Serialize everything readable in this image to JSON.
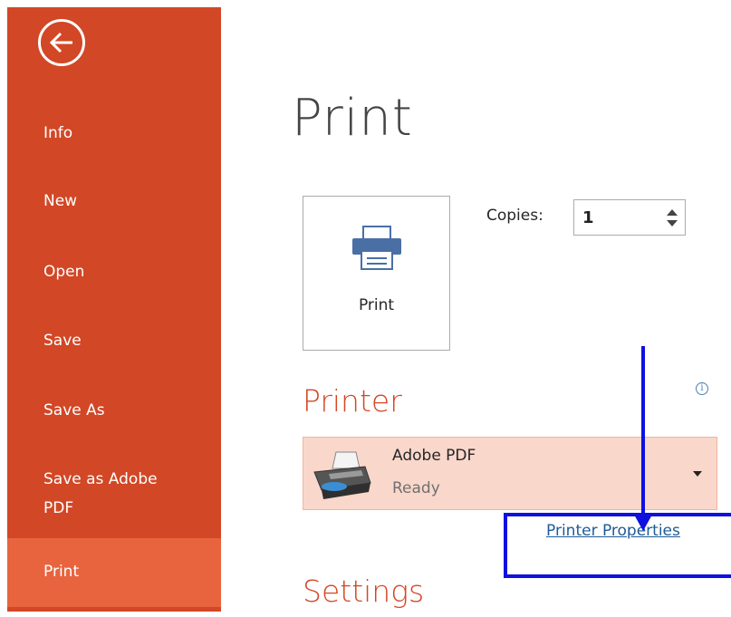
{
  "sidebar": {
    "items": [
      {
        "label": "Info"
      },
      {
        "label": "New"
      },
      {
        "label": "Open"
      },
      {
        "label": "Save"
      },
      {
        "label": "Save As"
      },
      {
        "label": "Save as Adobe PDF"
      },
      {
        "label": "Print"
      }
    ],
    "active_index": 6,
    "color": "#d24726",
    "active_color": "#e8643f"
  },
  "main": {
    "title": "Print",
    "print_button_label": "Print",
    "copies": {
      "label": "Copies:",
      "value": "1"
    },
    "printer": {
      "heading": "Printer",
      "name": "Adobe PDF",
      "status": "Ready",
      "properties_link": "Printer Properties"
    },
    "settings": {
      "heading": "Settings"
    }
  },
  "annotation": {
    "color": "#1010e0"
  },
  "icons": [
    "back-arrow-icon",
    "printer-icon",
    "info-icon",
    "adobe-pdf-printer-icon",
    "dropdown-arrow-icon"
  ]
}
